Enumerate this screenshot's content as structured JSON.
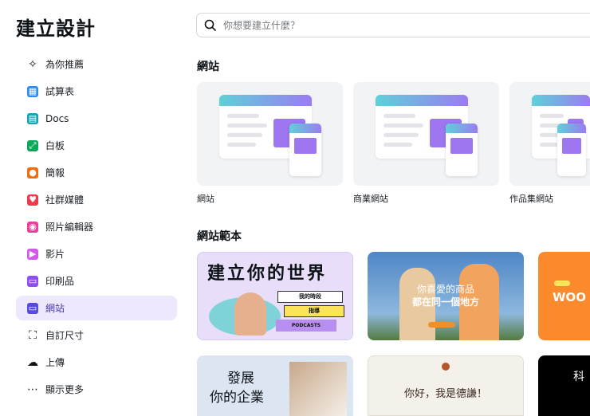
{
  "title": "建立設計",
  "search": {
    "placeholder": "你想要建立什麼？"
  },
  "sidebar": {
    "items": [
      {
        "label": "為你推薦",
        "icon": "sparkle-icon"
      },
      {
        "label": "試算表",
        "icon": "spreadsheet-icon",
        "color": "#2d8cf0"
      },
      {
        "label": "Docs",
        "icon": "docs-icon",
        "color": "#13a3b5"
      },
      {
        "label": "白板",
        "icon": "whiteboard-icon",
        "color": "#0ea65a"
      },
      {
        "label": "簡報",
        "icon": "presentation-icon",
        "color": "#f26b0f"
      },
      {
        "label": "社群媒體",
        "icon": "social-media-icon",
        "color": "#ee3a4c"
      },
      {
        "label": "照片編輯器",
        "icon": "photo-editor-icon",
        "color": "#ec3d9b"
      },
      {
        "label": "影片",
        "icon": "video-icon",
        "color": "#d35ae8"
      },
      {
        "label": "印刷品",
        "icon": "print-icon",
        "color": "#8f4ef0"
      },
      {
        "label": "網站",
        "icon": "website-icon",
        "color": "#5a4be0",
        "active": true
      },
      {
        "label": "自訂尺寸",
        "icon": "custom-size-icon"
      },
      {
        "label": "上傳",
        "icon": "upload-icon"
      },
      {
        "label": "顯示更多",
        "icon": "more-icon"
      }
    ]
  },
  "websites": {
    "heading": "網站",
    "cards": [
      {
        "label": "網站"
      },
      {
        "label": "商業網站"
      },
      {
        "label": "作品集網站"
      }
    ]
  },
  "templates": {
    "heading": "網站範本",
    "items": [
      {
        "title": "建立你的世界",
        "buttons": [
          "我的時段",
          "指導",
          "PODCASTS"
        ]
      },
      {
        "title": "你喜愛的商品",
        "subtitle": "都在同一個地方"
      },
      {
        "title": "WOO"
      },
      {
        "title": "發展",
        "subtitle": "你的企業"
      },
      {
        "title": "你好，我是德謙！"
      },
      {
        "title": "科"
      }
    ]
  }
}
